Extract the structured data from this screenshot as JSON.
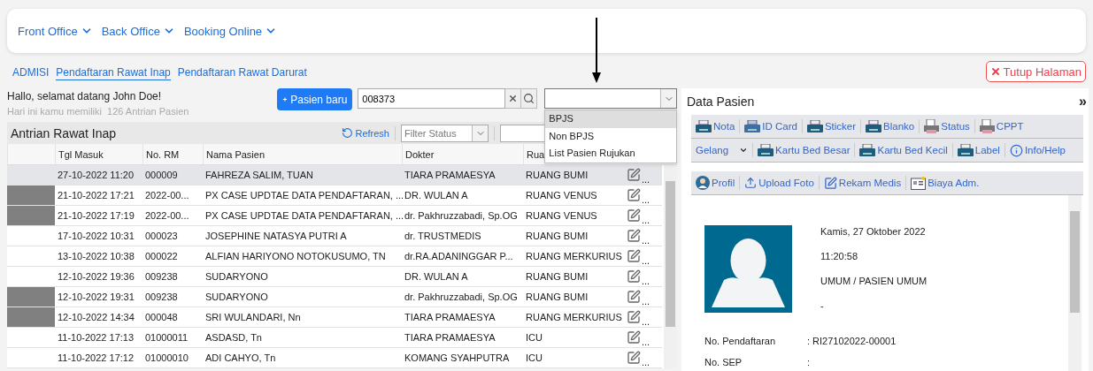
{
  "nav_menu": [
    {
      "label": "Front Office"
    },
    {
      "label": "Back Office"
    },
    {
      "label": "Booking Online"
    }
  ],
  "tabs": [
    {
      "label": "ADMISI",
      "selected": false
    },
    {
      "label": "Pendaftaran Rawat Inap",
      "selected": true
    },
    {
      "label": "Pendaftaran Rawat Darurat",
      "selected": false
    }
  ],
  "close_button": "Tutup Halaman",
  "greeting": "Hallo, selamat datang John Doe!",
  "queue_info": "Hari ini kamu memiliki  126 Antrian Pasien",
  "new_patient_button": "Pasien baru",
  "search": {
    "value": "008373"
  },
  "type_select": {
    "expanded": true,
    "options": [
      {
        "label": "BPJS",
        "selected": true
      },
      {
        "label": "Non BPJS",
        "selected": false
      },
      {
        "label": "List Pasien Rujukan",
        "selected": false
      }
    ]
  },
  "queue": {
    "title": "Antrian Rawat Inap",
    "refresh": "Refresh",
    "status_filter": {
      "placeholder": "Filter Status"
    },
    "columns": [
      "Tgl Masuk",
      "No. RM",
      "Nama Pasien",
      "Dokter",
      "Rua"
    ],
    "rows": [
      {
        "date": "27-10-2022 11:20",
        "rm": "000009",
        "name": "FAHREZA SALIM, TUAN",
        "doctor": "TIARA PRAMAESYA",
        "room": "RUANG BUMI",
        "more": "...",
        "selected": true
      },
      {
        "date": "21-10-2022 17:21",
        "rm": "2022-00...",
        "name": "PX CASE UPDTAE DATA PENDAFTARAN, ...",
        "doctor": "DR. WULAN A",
        "room": "RUANG VENUS",
        "more": "...",
        "selected": false,
        "color": "#808080"
      },
      {
        "date": "21-10-2022 17:19",
        "rm": "2022-00...",
        "name": "PX CASE UPDTAE DATA PENDAFTARAN, ...",
        "doctor": "dr. Pakhruzzabadi, Sp.OG",
        "room": "RUANG VENUS",
        "more": "...",
        "selected": false,
        "color": "#808080"
      },
      {
        "date": "17-10-2022 10:31",
        "rm": "000023",
        "name": "JOSEPHINE NATASYA PUTRI A",
        "doctor": "dr. TRUSTMEDIS",
        "room": "RUANG BUMI",
        "more": "...",
        "selected": false
      },
      {
        "date": "13-10-2022 10:38",
        "rm": "000022",
        "name": "ALFIAN HARIYONO NOTOKUSUMO, TN",
        "doctor": "dr.RA.ADANINGGAR P...",
        "room": "RUANG MERKURIUS",
        "more": "...",
        "selected": false
      },
      {
        "date": "12-10-2022 19:36",
        "rm": "009238",
        "name": "SUDARYONO",
        "doctor": "DR. WULAN A",
        "room": "RUANG BUMI",
        "more": "...",
        "selected": false
      },
      {
        "date": "12-10-2022 19:31",
        "rm": "009238",
        "name": "SUDARYONO",
        "doctor": "dr. Pakhruzzabadi, Sp.OG",
        "room": "RUANG BUMI",
        "more": "...",
        "selected": false,
        "color": "#808080"
      },
      {
        "date": "12-10-2022 14:34",
        "rm": "000048",
        "name": "SRI WULANDARI, Nn",
        "doctor": "TIARA PRAMAESYA",
        "room": "RUANG MERKURIUS",
        "more": "...",
        "selected": false,
        "color": "#808080"
      },
      {
        "date": "11-10-2022 17:13",
        "rm": "01000011",
        "name": "ASDASD, Tn",
        "doctor": "TIARA PRAMAESYA",
        "room": "ICU",
        "more": "...",
        "selected": false
      },
      {
        "date": "11-10-2022 17:12",
        "rm": "01000010",
        "name": "ADI CAHYO, Tn",
        "doctor": "KOMANG SYAHPUTRA",
        "room": "ICU",
        "more": "...",
        "selected": false
      }
    ]
  },
  "patient_panel": {
    "title": "Data Pasien",
    "collapse": "»",
    "toolbars": [
      [
        {
          "label": "Nota",
          "kind": "printer"
        },
        {
          "label": "ID Card",
          "kind": "card-printer"
        },
        {
          "label": "Sticker",
          "kind": "printer"
        },
        {
          "label": "Blanko",
          "kind": "printer"
        },
        {
          "label": "Status",
          "kind": "document-printer"
        },
        {
          "label": "CPPT",
          "kind": "document-printer"
        }
      ],
      [
        {
          "label": "Gelang",
          "kind": "dropdown"
        },
        {
          "label": "Kartu Bed Besar",
          "kind": "printer"
        },
        {
          "label": "Kartu Bed Kecil",
          "kind": "printer"
        },
        {
          "label": "Label",
          "kind": "printer"
        },
        {
          "label": "Info/Help",
          "kind": "info"
        }
      ],
      [
        {
          "label": "Profil",
          "kind": "person"
        },
        {
          "label": "Upload Foto",
          "kind": "upload"
        },
        {
          "label": "Rekam Medis",
          "kind": "edit-document"
        },
        {
          "label": "Biaya Adm.",
          "kind": "board"
        }
      ]
    ],
    "date": "Kamis, 27 Oktober 2022",
    "time": "11:20:58",
    "category": "UMUM / PASIEN UMUM",
    "note": "-",
    "fields": [
      {
        "label": "No. Pendaftaran",
        "value": ": RI27102022-00001"
      },
      {
        "label": "No. SEP",
        "value": ":"
      }
    ]
  }
}
